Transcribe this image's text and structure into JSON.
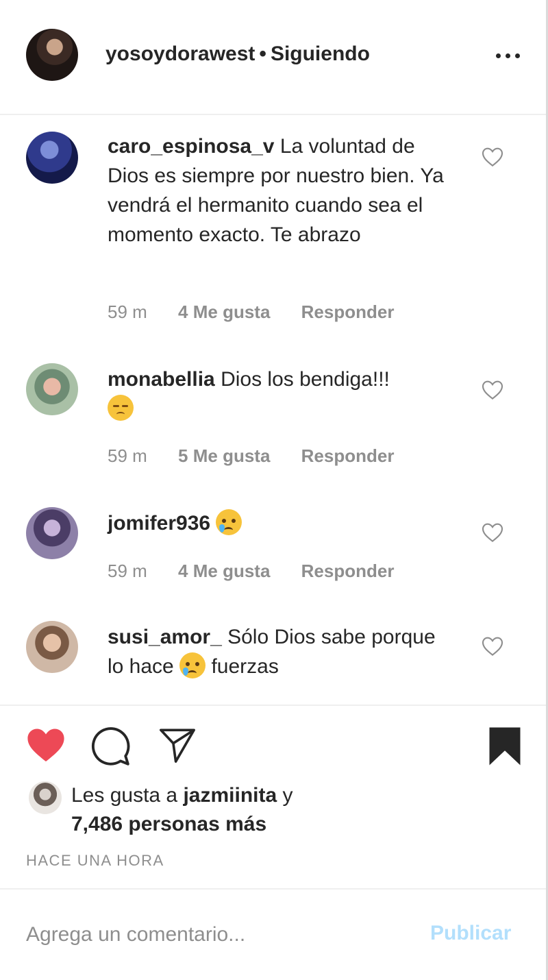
{
  "header": {
    "username": "yosoydorawest",
    "separator": "•",
    "follow_status": "Siguiendo"
  },
  "comments": [
    {
      "user": "caro_espinosa_v",
      "text": "La voluntad de Dios es siempre por nuestro bien. Ya vendrá el hermanito cuando sea el momento exacto. Te abrazo",
      "time": "59 m",
      "likes": "4 Me gusta",
      "reply": "Responder"
    },
    {
      "user": "monabellia",
      "text": "Dios los bendiga!!!",
      "emoji": "pensive-face",
      "time": "59 m",
      "likes": "5 Me gusta",
      "reply": "Responder"
    },
    {
      "user": "jomifer936",
      "text": "",
      "emoji": "crying-face",
      "time": "59 m",
      "likes": "4 Me gusta",
      "reply": "Responder"
    },
    {
      "user": "susi_amor_",
      "text_before": "Sólo Dios sabe porque lo hace",
      "emoji": "crying-face",
      "text_after": "fuerzas"
    }
  ],
  "actions": {
    "like_icon": "heart-filled-icon",
    "comment_icon": "comment-bubble-icon",
    "share_icon": "paper-plane-icon",
    "save_icon": "bookmark-filled-icon",
    "like_color": "#ed4956"
  },
  "likes_summary": {
    "prefix": "Les gusta a",
    "user": "jazmiinita",
    "conjunction": "y",
    "others": "7,486 personas más"
  },
  "timestamp": "HACE UNA HORA",
  "comment_box": {
    "placeholder": "Agrega un comentario...",
    "publish_label": "Publicar",
    "publish_color": "#b2dffc"
  }
}
